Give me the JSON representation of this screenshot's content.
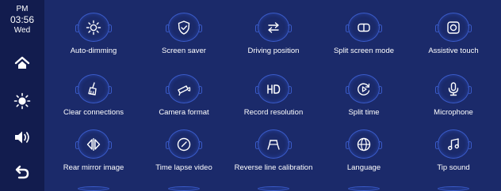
{
  "clock": {
    "ampm": "PM",
    "time": "03:56",
    "day": "Wed"
  },
  "settings": [
    {
      "label": "Auto-dimming",
      "icon": "sun-icon"
    },
    {
      "label": "Screen saver",
      "icon": "shield-check-icon"
    },
    {
      "label": "Driving position",
      "icon": "swap-arrows-icon"
    },
    {
      "label": "Split screen mode",
      "icon": "split-screen-icon"
    },
    {
      "label": "Assistive touch",
      "icon": "touch-circle-icon"
    },
    {
      "label": "Clear connections",
      "icon": "broom-icon"
    },
    {
      "label": "Camera format",
      "icon": "camera-icon"
    },
    {
      "label": "Record resolution",
      "icon": "hd-icon"
    },
    {
      "label": "Split time",
      "icon": "play-cycle-icon"
    },
    {
      "label": "Microphone",
      "icon": "microphone-icon"
    },
    {
      "label": "Rear mirror image",
      "icon": "mirror-arrows-icon"
    },
    {
      "label": "Time lapse video",
      "icon": "timer-icon"
    },
    {
      "label": "Reverse line calibration",
      "icon": "reverse-lines-icon"
    },
    {
      "label": "Language",
      "icon": "globe-icon"
    },
    {
      "label": "Tip sound",
      "icon": "music-note-icon"
    }
  ]
}
